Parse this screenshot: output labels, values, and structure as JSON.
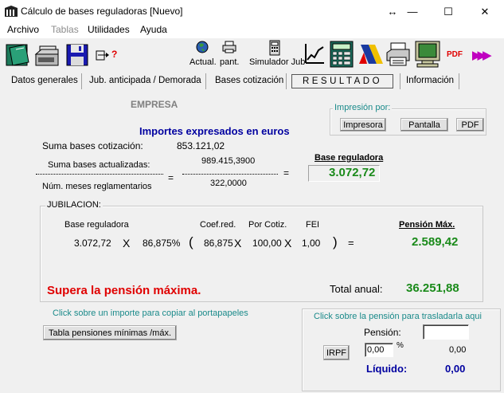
{
  "window": {
    "title": "Cálculo de bases reguladoras   [Nuevo]",
    "restore_glyph": "↔",
    "minimize_glyph": "—",
    "maximize_glyph": "☐",
    "close_glyph": "✕"
  },
  "menu": {
    "archivo": "Archivo",
    "tablas": "Tablas",
    "utilidades": "Utilidades",
    "ayuda": "Ayuda"
  },
  "toolbar": {
    "help_mark": "?",
    "actual_label": "Actual.",
    "pant_label": "pant.",
    "simulador_label": "Simulador Jub",
    "pdf_label": "PDF",
    "arrows_label": "▶▶▶"
  },
  "tabs": {
    "datos": "Datos generales",
    "jub_anticipada": "Jub. anticipada  / Demorada",
    "bases": "Bases cotización",
    "resultado": "RESULTADO",
    "informacion": "Información"
  },
  "main": {
    "empresa": "EMPRESA",
    "importes_title": "Importes expresados en euros",
    "impresion_group": "Impresión por:",
    "impresora_btn": "Impresora",
    "pantalla_btn": "Pantalla",
    "pdf_btn": "PDF",
    "suma_cot_label": "Suma bases cotización:",
    "suma_cot_value": "853.121,02",
    "suma_act_label": "Suma bases actualizadas:",
    "suma_act_value": "989.415,3900",
    "num_meses_label": "Núm. meses reglamentarios",
    "num_meses_value": "322,0000",
    "equals": "=",
    "base_reg_title": "Base reguladora",
    "base_reg_value": "3.072,72"
  },
  "jubilacion": {
    "group_title": "JUBILACION:",
    "base_label": "Base reguladora",
    "coef_label": "Coef.red.",
    "por_cotiz_label": "Por Cotiz.",
    "fei_label": "FEI",
    "pension_max_label": "Pensión Máx.",
    "base_value": "3.072,72",
    "x": "X",
    "pct_value": "86,875%",
    "paren_open": "(",
    "coef_value": "86,875",
    "por_cotiz_value": "100,00",
    "fei_value": "1,00",
    "paren_close": ")",
    "equals": "=",
    "pension_max_value": "2.589,42",
    "supera": "Supera la pensión máxima.",
    "total_anual_label": "Total anual:",
    "total_anual_value": "36.251,88"
  },
  "footer": {
    "click_importe": "Click sobre un importe para copiar al portapapeles",
    "tabla_btn": "Tabla pensiones mínimas /máx.",
    "click_pension": "Click sobre la pensión para trasladarla aqui",
    "pension_label": "Pensión:",
    "pension_input": "",
    "irpf_btn": "IRPF",
    "irpf_input": "0,00",
    "pct_sign": "%",
    "irpf_amount": "0,00",
    "liquido_label": "Líquido:",
    "liquido_value": "0,00"
  },
  "colors": {
    "accent_blue": "#0000a0",
    "green": "#1a8a1a",
    "red": "#e00000",
    "teal": "#1a8a8a"
  }
}
